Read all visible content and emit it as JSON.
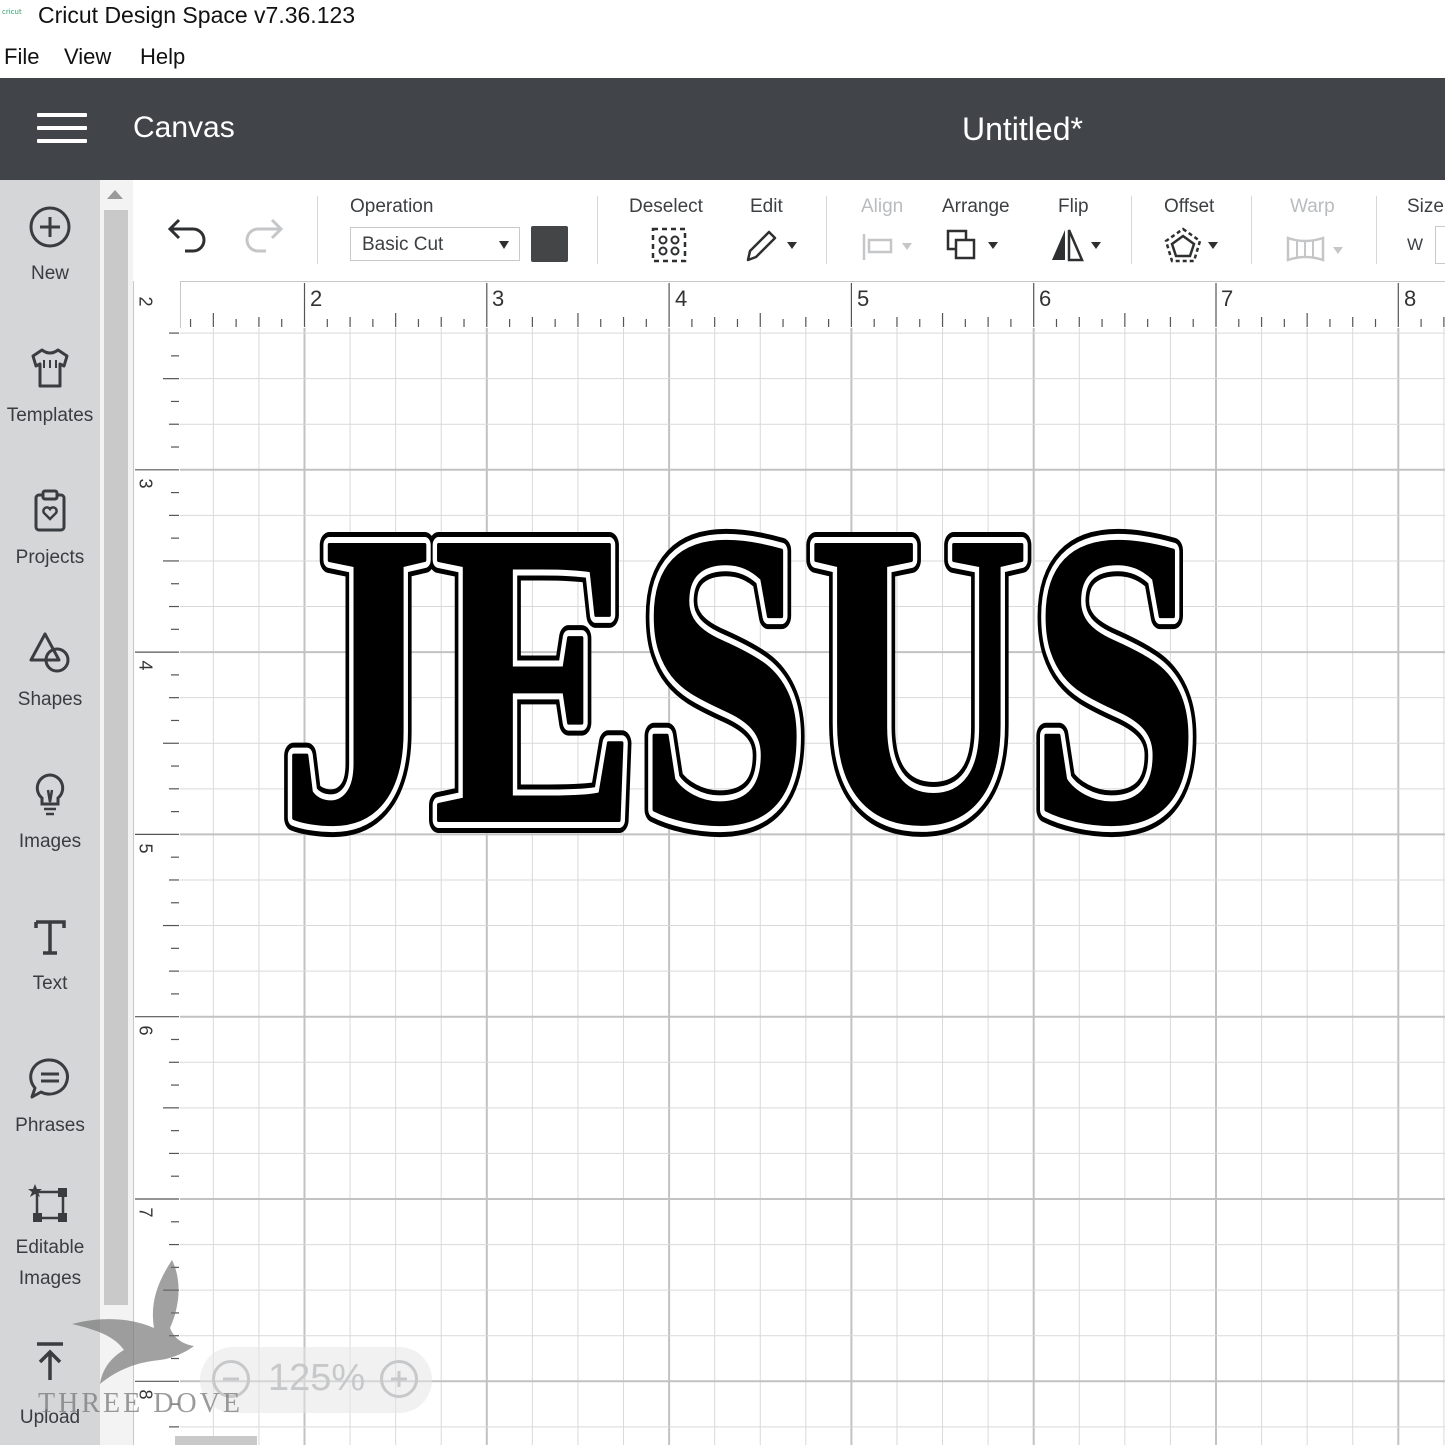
{
  "window": {
    "app_icon_text": "cricut",
    "title": "Cricut Design Space  v7.36.123"
  },
  "menu": [
    "File",
    "View",
    "Help"
  ],
  "header": {
    "section": "Canvas",
    "document_title": "Untitled*"
  },
  "sidebar": [
    {
      "label": "New",
      "icon": "plus-circle-icon"
    },
    {
      "label": "Templates",
      "icon": "tshirt-icon"
    },
    {
      "label": "Projects",
      "icon": "clipboard-icon"
    },
    {
      "label": "Shapes",
      "icon": "shapes-icon"
    },
    {
      "label": "Images",
      "icon": "lightbulb-icon"
    },
    {
      "label": "Text",
      "icon": "text-t-icon"
    },
    {
      "label": "Phrases",
      "icon": "speech-bubble-icon"
    },
    {
      "label": "Editable",
      "label2": "Images",
      "icon": "editable-image-icon"
    },
    {
      "label": "Upload",
      "icon": "upload-icon"
    }
  ],
  "toolbar": {
    "operation_label": "Operation",
    "operation_value": "Basic Cut",
    "operation_color": "#434547",
    "deselect": "Deselect",
    "edit": "Edit",
    "align": "Align",
    "arrange": "Arrange",
    "flip": "Flip",
    "offset": "Offset",
    "warp": "Warp",
    "size": "Size",
    "size_w": "W"
  },
  "ruler": {
    "horizontal": [
      "2",
      "3",
      "4",
      "5",
      "6",
      "7",
      "8"
    ],
    "vertical": [
      "2",
      "3",
      "4",
      "5",
      "6",
      "7",
      "8"
    ]
  },
  "canvas_text": "JESUS",
  "zoom": "125%",
  "watermark": "THREE DOVE",
  "colors": {
    "header_bg": "#414549",
    "sidebar_bg": "#d4d6d8",
    "grid_line": "#d9d9d9",
    "grid_major": "#c2c2c2"
  }
}
